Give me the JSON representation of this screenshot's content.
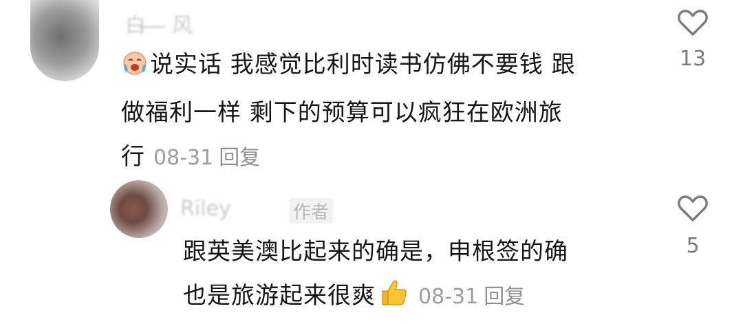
{
  "comments": [
    {
      "username": "白 ̶ ̶ ̶ 风",
      "text_line1": "说实话 我感觉比利时读书仿佛不要钱 跟",
      "text_line2": "做福利一样 剩下的预算可以疯狂在欧洲旅",
      "text_line3": "行",
      "date": "08-31",
      "reply_label": "回复",
      "like_count": "13",
      "emoji": "crying-laughing-face"
    },
    {
      "username": "Riley",
      "author_tag": "作者",
      "text_line1": "跟英美澳比起来的确是，申根签的确",
      "text_line2": "也是旅游起来很爽",
      "date": "08-31",
      "reply_label": "回复",
      "like_count": "5",
      "emoji": "thumbs-up"
    }
  ],
  "colors": {
    "text": "#161616",
    "meta": "#9c9c9c",
    "icon": "#7a7a7a"
  }
}
